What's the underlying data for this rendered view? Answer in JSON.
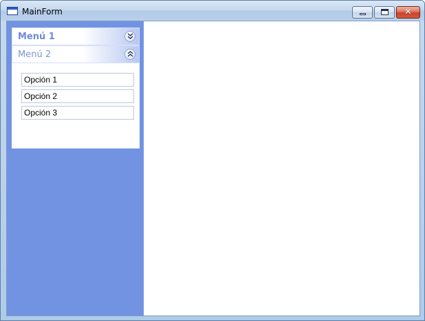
{
  "window": {
    "title": "MainForm",
    "controls": {
      "minimize": "minimize",
      "maximize": "maximize",
      "close_glyph": "✕"
    }
  },
  "sidebar": {
    "background": "#7293e2",
    "groups": [
      {
        "label": "Menú 1",
        "expanded": false,
        "chevron": "chevron-double-down-icon"
      },
      {
        "label": "Menú 2",
        "expanded": true,
        "chevron": "chevron-double-up-icon",
        "items": [
          "Opción 1",
          "Opción 2",
          "Opción 3"
        ]
      }
    ]
  },
  "icons": {
    "app": "window-app-icon"
  }
}
